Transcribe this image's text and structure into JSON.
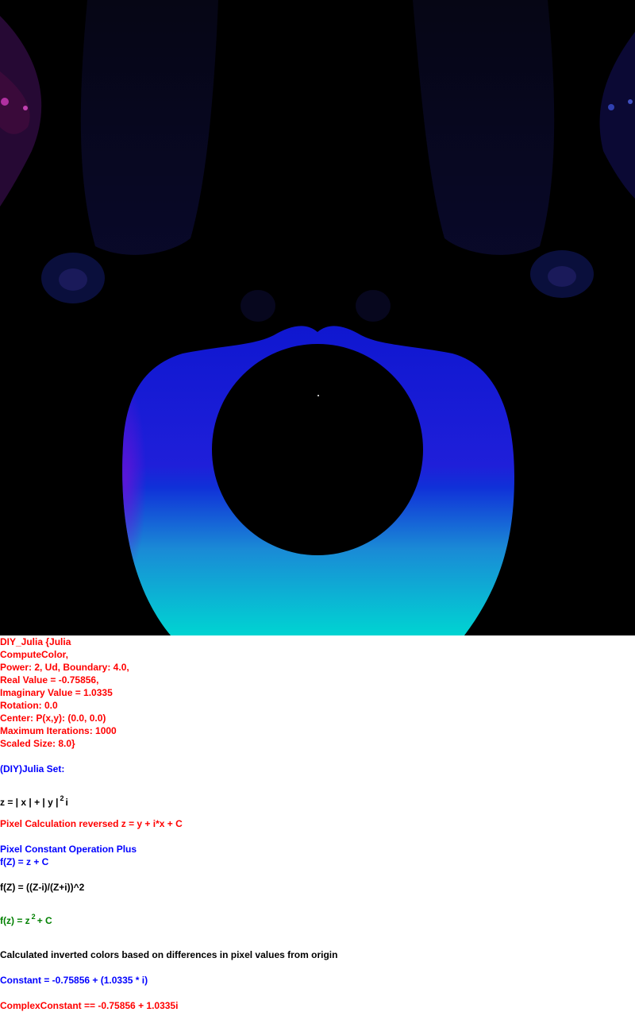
{
  "params": {
    "title": "DIY_Julia {Julia",
    "compute": "ComputeColor,",
    "power": "Power: 2, Ud, Boundary: 4.0,",
    "real": "Real Value = -0.75856,",
    "imag": "Imaginary Value = 1.0335",
    "rotation": "Rotation: 0.0",
    "center": "Center: P(x,y): (0.0, 0.0)",
    "iterations": "Maximum Iterations: 1000",
    "scaled": "Scaled Size: 8.0}"
  },
  "set_title": "(DIY)Julia Set:",
  "formula_z": {
    "base": "z = | x | + | y |",
    "exp": "2",
    "suffix": "i"
  },
  "pixel_calc": "Pixel Calculation reversed z = y + i*x + C",
  "pixel_const": "Pixel Constant Operation Plus",
  "fz1": "f(Z) = z + C",
  "fz2": "f(Z) = ((Z-i)/(Z+i))^2",
  "fz3": {
    "base": "f(z) = z",
    "exp": "2",
    "suffix": "+ C"
  },
  "inverted": "Calculated inverted colors based on differences in pixel values from origin",
  "constant": "Constant = -0.75856 + (1.0335 * i)",
  "complex_constant": "ComplexConstant == -0.75856 + 1.0335i"
}
